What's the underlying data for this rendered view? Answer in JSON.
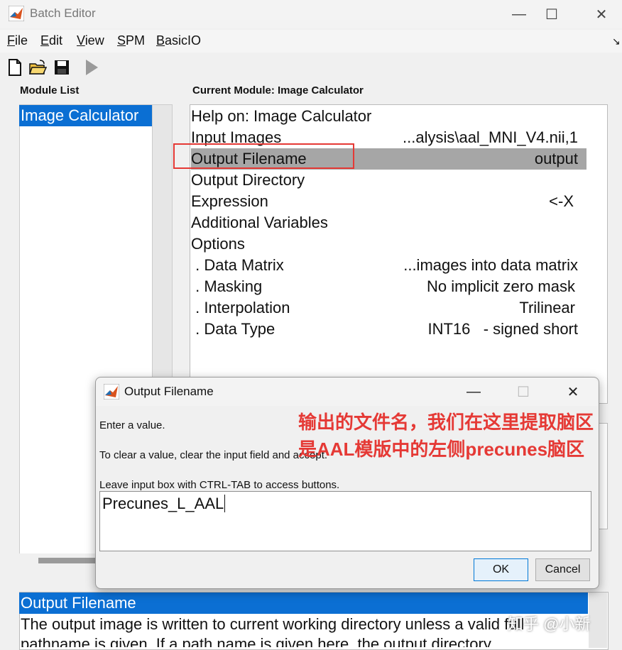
{
  "window": {
    "title": "Batch Editor",
    "minimize": "—",
    "maximize": "☐",
    "close": "✕"
  },
  "menu": [
    {
      "key": "F",
      "rest": "ile"
    },
    {
      "key": "E",
      "rest": "dit"
    },
    {
      "key": "V",
      "rest": "iew"
    },
    {
      "key": "S",
      "rest": "PM"
    },
    {
      "key": "B",
      "rest": "asicIO"
    }
  ],
  "menu_overflow": "↘",
  "panels": {
    "module_list_header": "Module List",
    "module_list_items": [
      "Image Calculator"
    ],
    "current_module_header": "Current Module: Image Calculator"
  },
  "module_rows": [
    {
      "key": "Help on: Image Calculator",
      "value": ""
    },
    {
      "key": "Input Images",
      "value": "...alysis\\aal_MNI_V4.nii,1"
    },
    {
      "key": "Output Filename",
      "value": "output"
    },
    {
      "key": "Output Directory",
      "value": ""
    },
    {
      "key": "Expression",
      "value": "<-X"
    },
    {
      "key": "Additional Variables",
      "value": ""
    },
    {
      "key": "Options",
      "value": ""
    },
    {
      "key": " . Data Matrix",
      "value": "...images into data matrix"
    },
    {
      "key": " . Masking",
      "value": "No implicit zero mask"
    },
    {
      "key": " . Interpolation",
      "value": "Trilinear"
    },
    {
      "key": " . Data Type",
      "value": "INT16   - signed short"
    }
  ],
  "help": {
    "title": "Output Filename",
    "text": "The output image is written to current working directory unless a valid full pathname is given. If a path name is given here, the output directory"
  },
  "watermark": "知乎 @小新",
  "dialog": {
    "title": "Output Filename",
    "minimize": "—",
    "maximize": "☐",
    "close": "✕",
    "line1": "Enter a value.",
    "line2": "To clear a value, clear the input field and accept.",
    "line3": "Leave input box with CTRL-TAB to access buttons.",
    "input_value": "Precunes_L_AAL",
    "ok_label": "OK",
    "cancel_label": "Cancel"
  },
  "annotation": "输出的文件名，我们在这里提取脑区是AAL模版中的左侧precunes脑区",
  "colors": {
    "selection_blue": "#0b6fd3",
    "row_selected": "#a6a6a6",
    "annotation_red": "#e53935"
  }
}
